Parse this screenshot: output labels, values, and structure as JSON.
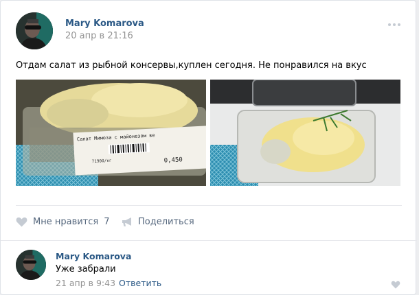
{
  "post": {
    "author": "Mary Komarova",
    "date": "20 апр в 21:16",
    "text": "Отдам салат из рыбной консервы,куплен сегодня. Не понравился на вкус",
    "photos": [
      {
        "label_line1": "Салат Мимоза с майонезом ве",
        "price": "71900/кг",
        "weight": "0,450"
      },
      {}
    ],
    "actions": {
      "like_label": "Мне нравится",
      "like_count": "7",
      "share_label": "Поделиться"
    }
  },
  "comment": {
    "author": "Mary Komarova",
    "text": "Уже забрали",
    "date": "21 апр в 9:43",
    "reply_label": "Ответить"
  },
  "icons": {
    "more": "more-horizontal-icon",
    "like": "heart-icon",
    "share": "megaphone-icon"
  },
  "colors": {
    "link": "#2a5885",
    "muted": "#939393",
    "action": "#55677d",
    "icon": "#c5cbd3"
  }
}
